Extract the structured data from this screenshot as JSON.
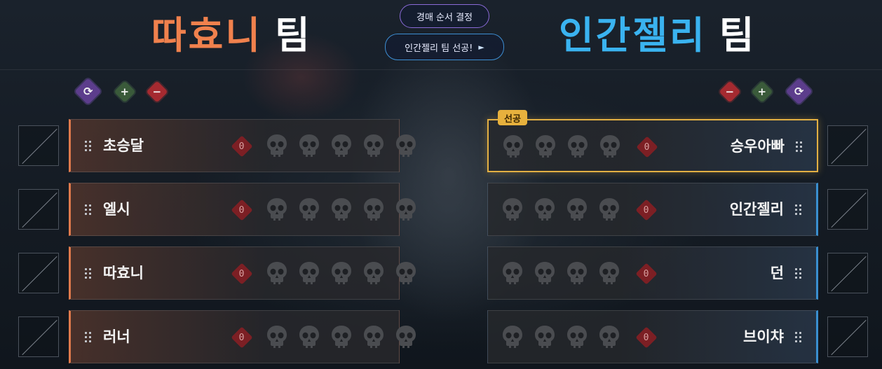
{
  "header": {
    "left_team": {
      "name": "따효니",
      "suffix": "팀",
      "color": "#f0814d"
    },
    "right_team": {
      "name": "인간젤리",
      "suffix": "팀",
      "color": "#3ab3f0"
    },
    "order_button_label": "경매 순서 결정",
    "first_pick_label": "인간젤리 팀 선공!",
    "first_pick_arrow": "►"
  },
  "left_controls": {
    "refresh": "⟳",
    "add": "+",
    "remove": "−"
  },
  "right_controls": {
    "refresh": "⟳",
    "add": "+",
    "remove": "−"
  },
  "first_pick_badge": "선공",
  "left_players": [
    {
      "name": "초승달",
      "score": "0",
      "skulls": 5
    },
    {
      "name": "엘시",
      "score": "0",
      "skulls": 5
    },
    {
      "name": "따효니",
      "score": "0",
      "skulls": 5
    },
    {
      "name": "러너",
      "score": "0",
      "skulls": 5
    }
  ],
  "right_players": [
    {
      "name": "승우아빠",
      "score": "0",
      "skulls": 4
    },
    {
      "name": "인간젤리",
      "score": "0",
      "skulls": 4
    },
    {
      "name": "던",
      "score": "0",
      "skulls": 4
    },
    {
      "name": "브이챠",
      "score": "0",
      "skulls": 4
    }
  ],
  "colors": {
    "left_accent": "#e07a4c",
    "right_accent": "#3a8fd0",
    "first_pick": "#e3b043"
  }
}
